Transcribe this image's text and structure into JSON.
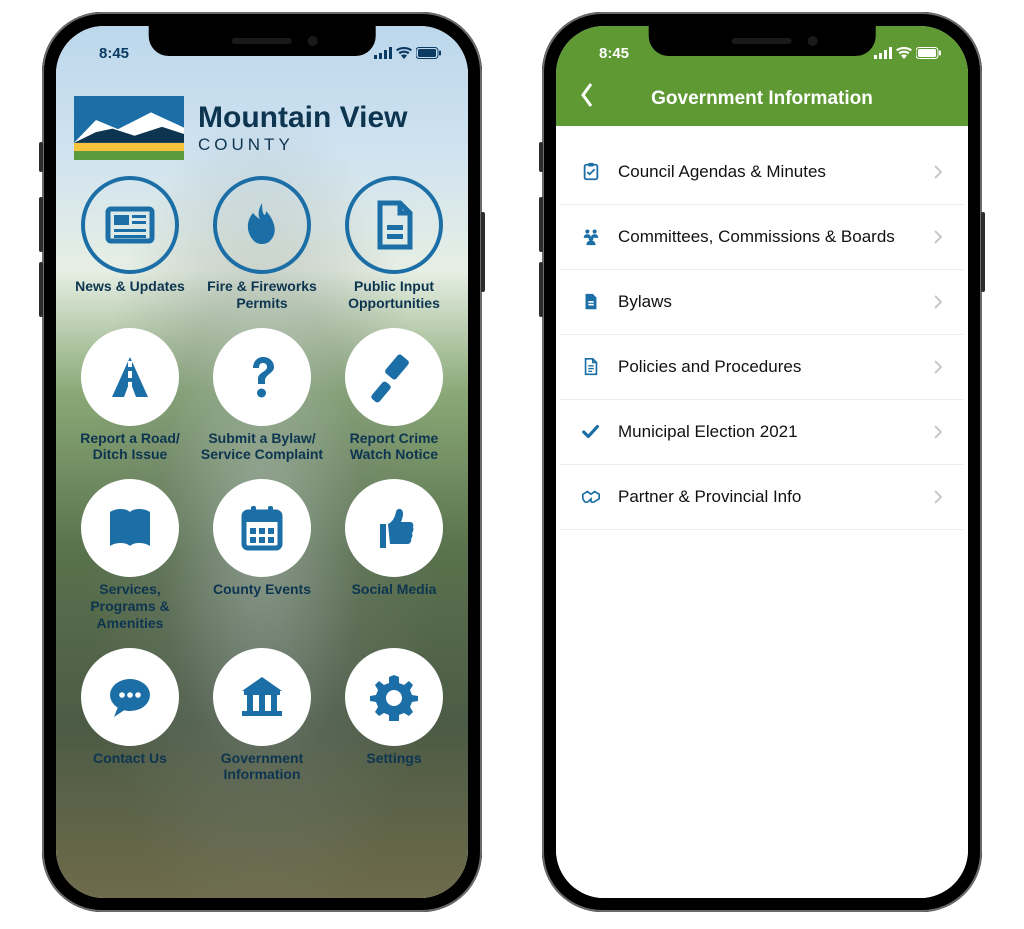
{
  "status": {
    "time": "8:45"
  },
  "colors": {
    "brand_blue": "#1b6ea6",
    "brand_navy": "#0d3550",
    "header_green": "#5e9933"
  },
  "home": {
    "brand_line1": "Mountain View",
    "brand_line2": "COUNTY",
    "tiles": [
      {
        "icon": "newspaper",
        "label": "News & Updates",
        "outline": true
      },
      {
        "icon": "flame",
        "label": "Fire & Fireworks Permits",
        "outline": true
      },
      {
        "icon": "document",
        "label": "Public Input Opportunities",
        "outline": true
      },
      {
        "icon": "road",
        "label": "Report a Road/\nDitch Issue",
        "outline": false
      },
      {
        "icon": "question",
        "label": "Submit a Bylaw/\nService Complaint",
        "outline": false
      },
      {
        "icon": "gavel",
        "label": "Report Crime Watch Notice",
        "outline": false
      },
      {
        "icon": "book",
        "label": "Services, Programs & Amenities",
        "outline": false
      },
      {
        "icon": "calendar",
        "label": "County Events",
        "outline": false
      },
      {
        "icon": "thumbs-up",
        "label": "Social Media",
        "outline": false
      },
      {
        "icon": "chat",
        "label": "Contact Us",
        "outline": false
      },
      {
        "icon": "bank",
        "label": "Government Information",
        "outline": false
      },
      {
        "icon": "gear",
        "label": "Settings",
        "outline": false
      }
    ]
  },
  "detail": {
    "title": "Government Information",
    "rows": [
      {
        "icon": "clipboard",
        "label": "Council Agendas & Minutes"
      },
      {
        "icon": "people",
        "label": "Committees, Commissions & Boards"
      },
      {
        "icon": "doc",
        "label": "Bylaws"
      },
      {
        "icon": "doc-lines",
        "label": "Policies and Procedures"
      },
      {
        "icon": "check",
        "label": "Municipal Election 2021"
      },
      {
        "icon": "handshake",
        "label": "Partner & Provincial Info"
      }
    ]
  }
}
